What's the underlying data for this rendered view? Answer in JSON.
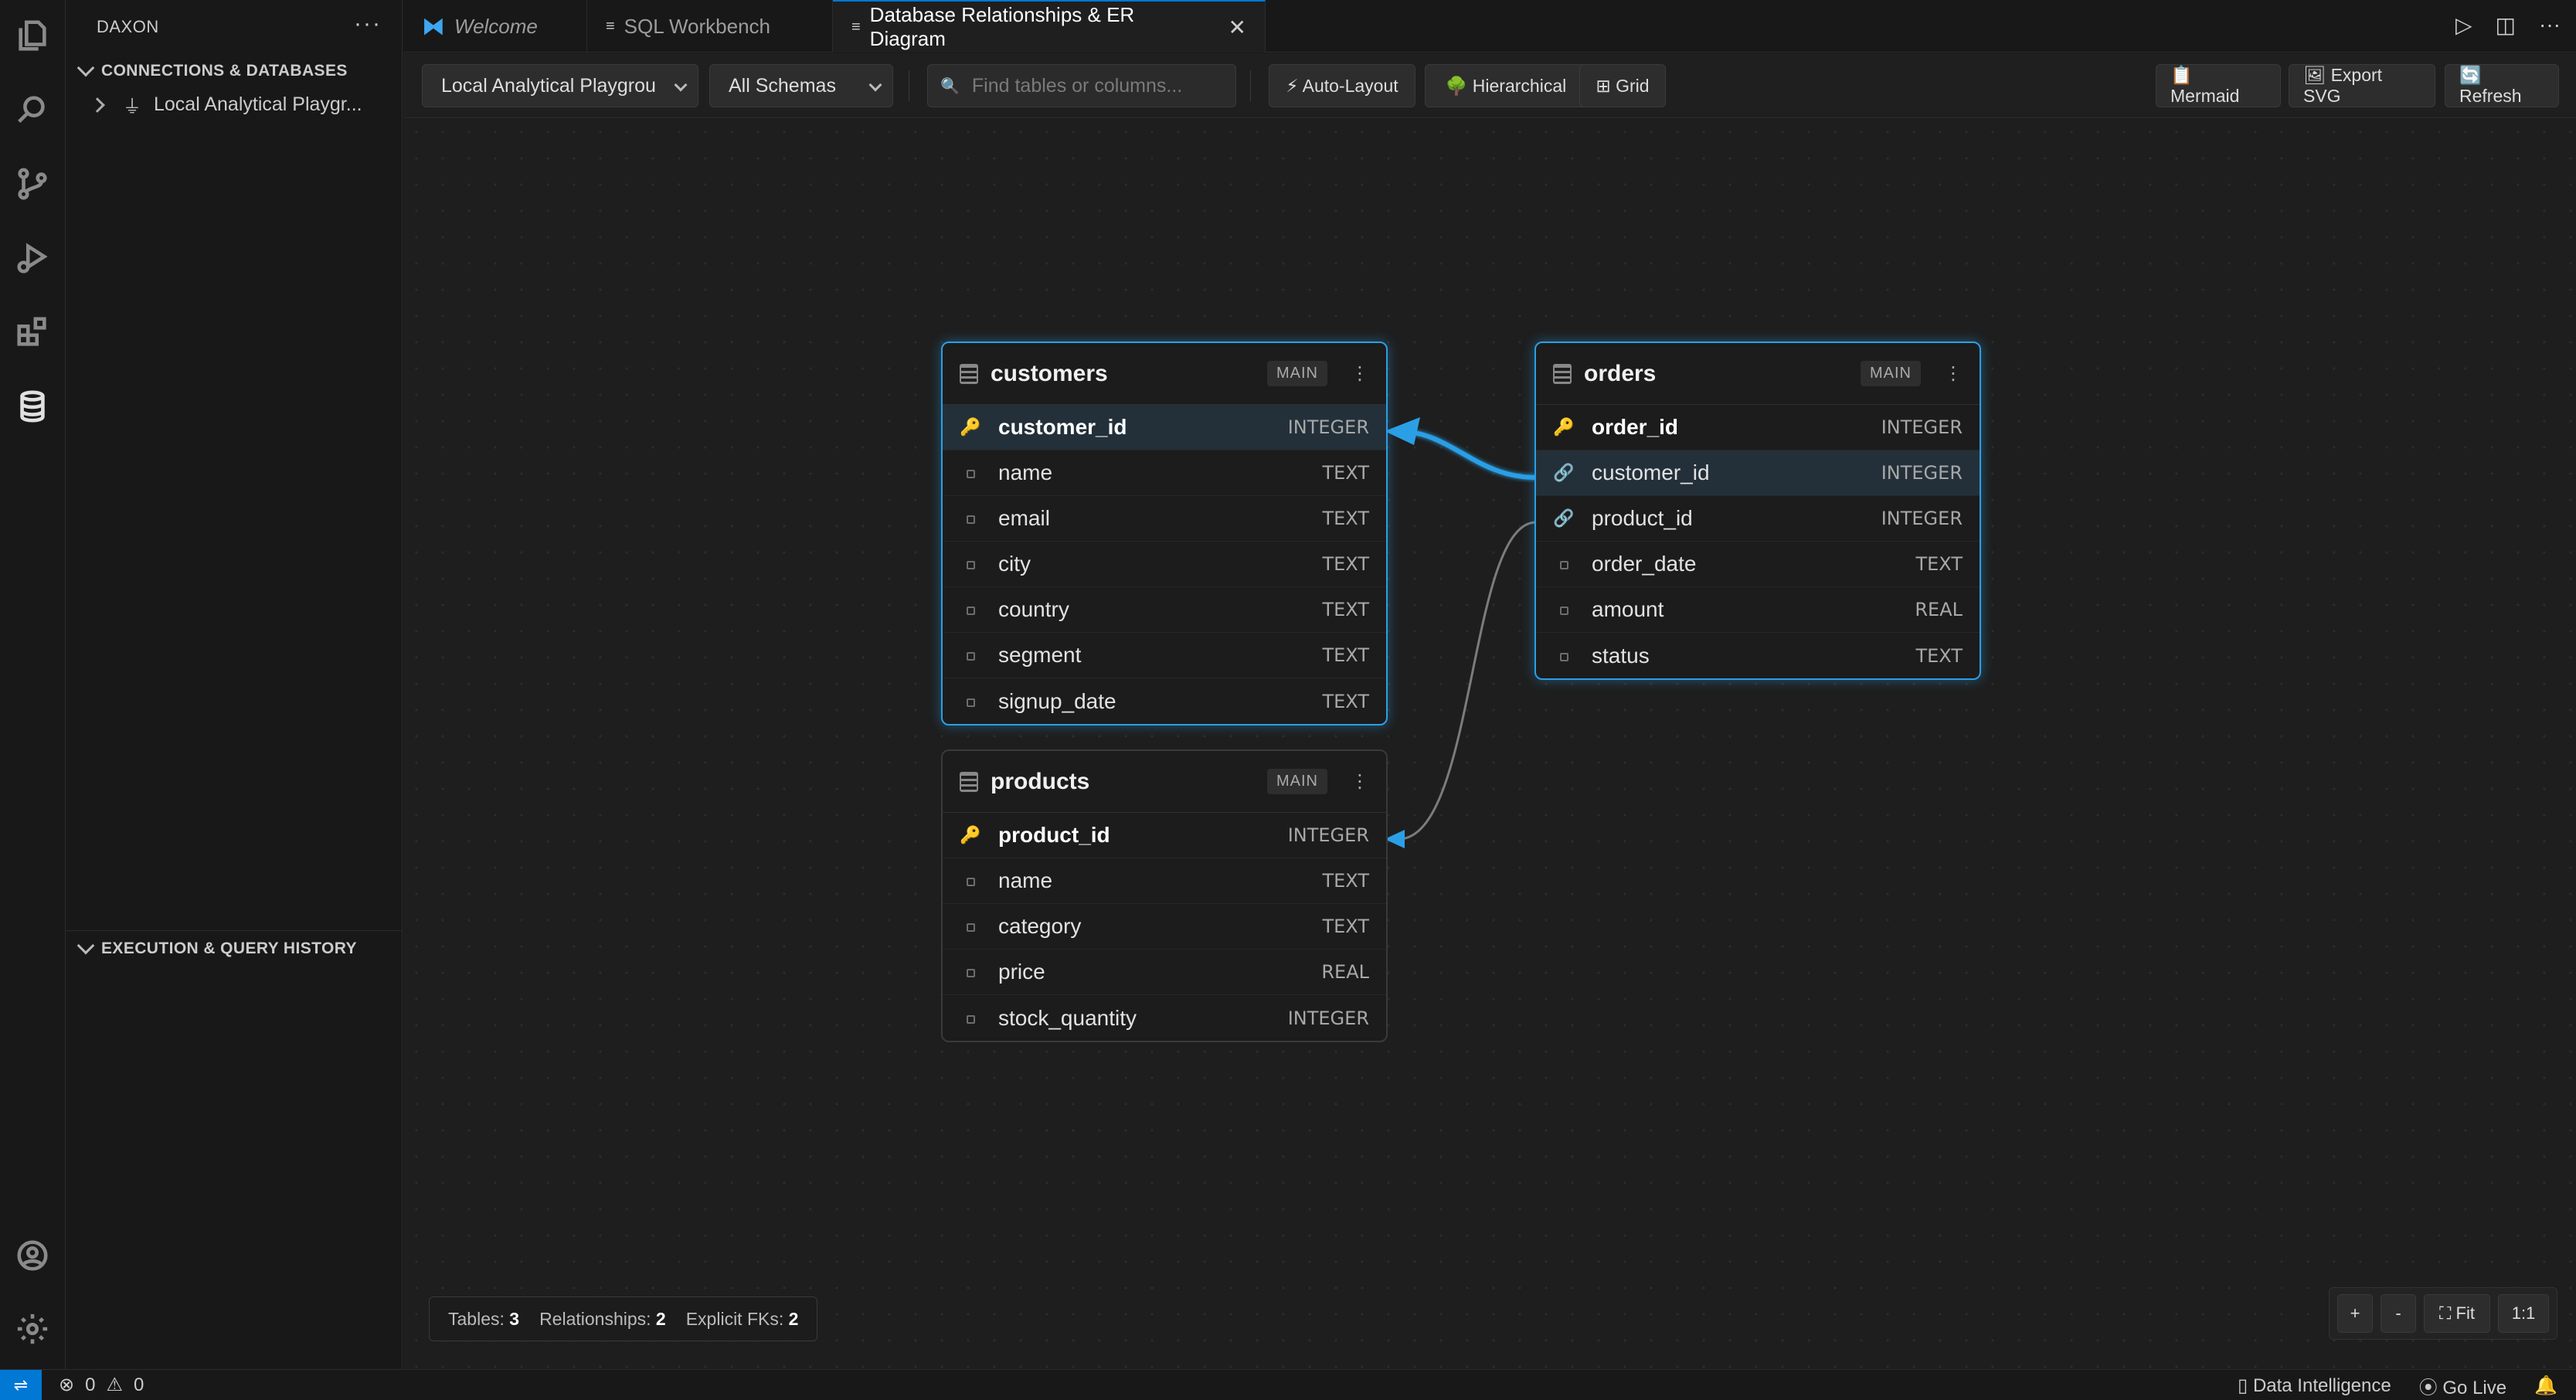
{
  "sidebar": {
    "title": "DAXON",
    "more": "···",
    "connections_header": "CONNECTIONS & DATABASES",
    "connection_item": "Local Analytical Playgr...",
    "history_header": "EXECUTION & QUERY HISTORY"
  },
  "tabs": [
    {
      "label": "Welcome"
    },
    {
      "label": "SQL Workbench"
    },
    {
      "label": "Database Relationships & ER Diagram"
    }
  ],
  "toolbar": {
    "connection_select": "Local Analytical Playgrou",
    "schema_select": "All Schemas",
    "search_placeholder": "Find tables or columns...",
    "auto_layout": "⚡ Auto-Layout",
    "hierarchical": "🌳 Hierarchical",
    "grid": "⊞ Grid",
    "mermaid": "📋 Mermaid",
    "export_svg": "🖼 Export SVG",
    "refresh": "🔄 Refresh"
  },
  "tables": {
    "customers": {
      "name": "customers",
      "schema": "MAIN",
      "columns": [
        {
          "name": "customer_id",
          "type": "INTEGER",
          "icon": "key-icon"
        },
        {
          "name": "name",
          "type": "TEXT",
          "icon": "column-dot-icon"
        },
        {
          "name": "email",
          "type": "TEXT",
          "icon": "column-dot-icon"
        },
        {
          "name": "city",
          "type": "TEXT",
          "icon": "column-dot-icon"
        },
        {
          "name": "country",
          "type": "TEXT",
          "icon": "column-dot-icon"
        },
        {
          "name": "segment",
          "type": "TEXT",
          "icon": "column-dot-icon"
        },
        {
          "name": "signup_date",
          "type": "TEXT",
          "icon": "column-dot-icon"
        }
      ]
    },
    "orders": {
      "name": "orders",
      "schema": "MAIN",
      "columns": [
        {
          "name": "order_id",
          "type": "INTEGER",
          "icon": "key-icon"
        },
        {
          "name": "customer_id",
          "type": "INTEGER",
          "icon": "link-icon"
        },
        {
          "name": "product_id",
          "type": "INTEGER",
          "icon": "link-icon"
        },
        {
          "name": "order_date",
          "type": "TEXT",
          "icon": "column-dot-icon"
        },
        {
          "name": "amount",
          "type": "REAL",
          "icon": "column-dot-icon"
        },
        {
          "name": "status",
          "type": "TEXT",
          "icon": "column-dot-icon"
        }
      ]
    },
    "products": {
      "name": "products",
      "schema": "MAIN",
      "columns": [
        {
          "name": "product_id",
          "type": "INTEGER",
          "icon": "key-icon"
        },
        {
          "name": "name",
          "type": "TEXT",
          "icon": "column-dot-icon"
        },
        {
          "name": "category",
          "type": "TEXT",
          "icon": "column-dot-icon"
        },
        {
          "name": "price",
          "type": "REAL",
          "icon": "column-dot-icon"
        },
        {
          "name": "stock_quantity",
          "type": "INTEGER",
          "icon": "column-dot-icon"
        }
      ]
    }
  },
  "relationships": [
    {
      "from": "orders.customer_id",
      "to": "customers.customer_id",
      "highlighted": true
    },
    {
      "from": "orders.product_id",
      "to": "products.product_id",
      "highlighted": false
    }
  ],
  "stats": {
    "tables_label": "Tables:",
    "tables": "3",
    "relationships_label": "Relationships:",
    "relationships": "2",
    "fks_label": "Explicit FKs:",
    "fks": "2"
  },
  "zoom": {
    "in": "+",
    "out": "-",
    "fit": "⛶ Fit",
    "reset": "1:1"
  },
  "statusbar": {
    "errors": "0",
    "warnings": "0",
    "data_intelligence": "Data Intelligence",
    "go_live": "Go Live"
  },
  "colors": {
    "accent": "#2b9fe6",
    "key": "#e8b730",
    "status_remote": "#0078d4"
  }
}
